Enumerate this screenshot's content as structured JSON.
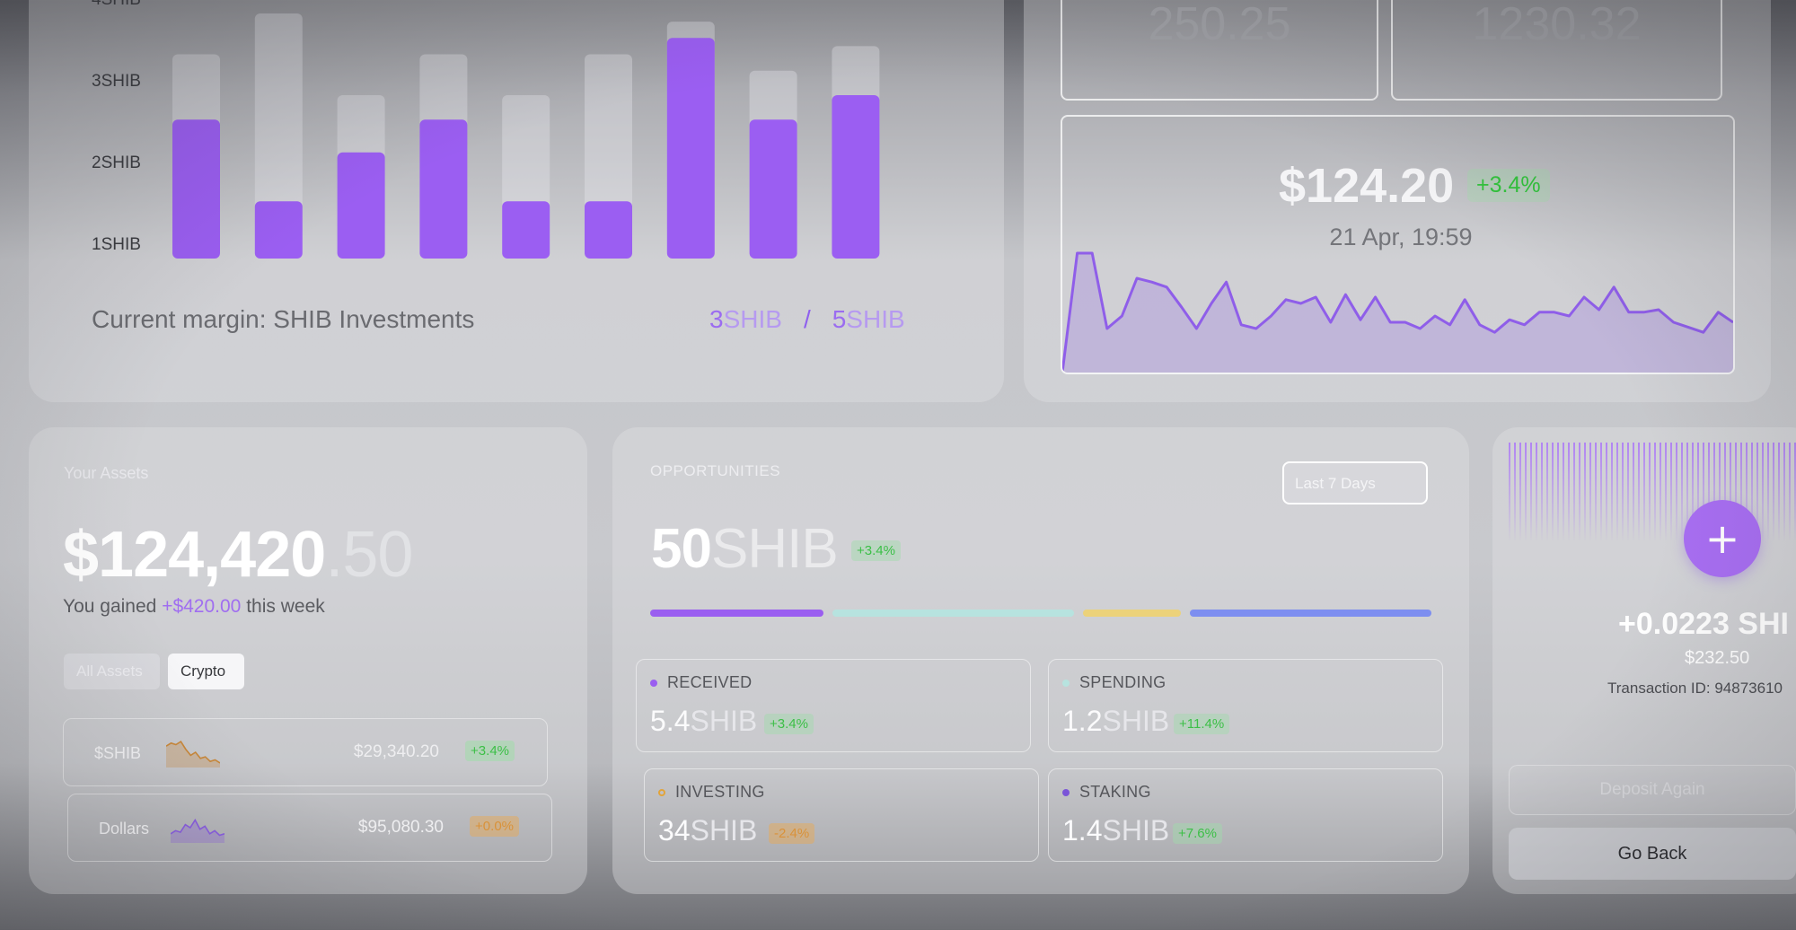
{
  "chart_data": {
    "type": "bar",
    "categories": [
      "",
      "",
      "",
      "",
      "",
      "",
      "",
      "",
      ""
    ],
    "values": [
      2.7,
      1.7,
      2.3,
      2.7,
      1.7,
      1.7,
      3.7,
      2.7,
      3.0
    ],
    "background_values": [
      3.5,
      4.0,
      3.0,
      3.5,
      3.0,
      3.5,
      3.9,
      3.3,
      3.6
    ],
    "yticks": [
      "1SHIB",
      "2SHIB",
      "3SHIB",
      "4SHIB"
    ],
    "ylim": [
      1,
      4
    ],
    "color": "#9b5ef2"
  },
  "margin": {
    "label": "Current margin: SHIB Investments",
    "current_num": "3",
    "current_unit": "SHIB",
    "separator": "/",
    "target_num": "5",
    "target_unit": "SHIB"
  },
  "stats": {
    "value_1": "250.25",
    "value_2": "1230.32"
  },
  "price": {
    "value": "$124.20",
    "change": "+3.4%",
    "date": "21 Apr, 19:59",
    "line": [
      0,
      0.95,
      0.95,
      0.35,
      0.45,
      0.75,
      0.72,
      0.68,
      0.52,
      0.35,
      0.55,
      0.72,
      0.38,
      0.35,
      0.45,
      0.58,
      0.55,
      0.6,
      0.4,
      0.62,
      0.42,
      0.6,
      0.4,
      0.4,
      0.35,
      0.45,
      0.38,
      0.58,
      0.38,
      0.32,
      0.42,
      0.38,
      0.48,
      0.48,
      0.45,
      0.6,
      0.5,
      0.68,
      0.48,
      0.48,
      0.5,
      0.4,
      0.36,
      0.32,
      0.48,
      0.4
    ]
  },
  "assets": {
    "title": "Your Assets",
    "total_main": "$124,420",
    "total_cents": ".50",
    "gained_prefix": "You gained",
    "gained_amount": "+$420.00",
    "gained_suffix": "this week",
    "tabs": [
      "All Assets",
      "Crypto"
    ],
    "rows": [
      {
        "name": "$SHIB",
        "value": "$29,340.20",
        "change": "+3.4%",
        "spark_color": "#c9883a",
        "spark": [
          0.7,
          0.8,
          0.75,
          0.85,
          0.6,
          0.4,
          0.5,
          0.3,
          0.35,
          0.2,
          0.25,
          0.15
        ]
      },
      {
        "name": "Dollars",
        "value": "$95,080.30",
        "change": "+0.0%",
        "spark_color": "#8a5ee0",
        "spark": [
          0.3,
          0.4,
          0.35,
          0.6,
          0.5,
          0.75,
          0.45,
          0.55,
          0.3,
          0.4,
          0.25,
          0.3
        ]
      }
    ]
  },
  "opportunities": {
    "title": "OPPORTUNITIES",
    "range_label": "Last 7 Days",
    "total_num": "50",
    "total_unit": "SHIB",
    "total_change": "+3.4%",
    "segments": [
      {
        "share": 0.23,
        "color": "#9a5ef0"
      },
      {
        "share": 0.32,
        "color": "#b7e3df"
      },
      {
        "share": 0.13,
        "color": "#ecd27a"
      },
      {
        "share": 0.32,
        "color": "#7d8ef0"
      }
    ],
    "metrics": [
      {
        "label": "RECEIVED",
        "num": "5.4",
        "unit": "SHIB",
        "change": "+3.4%",
        "dot_color": "#9a5ef0"
      },
      {
        "label": "SPENDING",
        "num": "1.2",
        "unit": "SHIB",
        "change": "+11.4%",
        "dot_color": "#b7e3df"
      },
      {
        "label": "INVESTING",
        "num": "34",
        "unit": "SHIB",
        "change": "-2.4%",
        "dot_color": "#e2a43a"
      },
      {
        "label": "STAKING",
        "num": "1.4",
        "unit": "SHIB",
        "change": "+7.6%",
        "dot_color": "#7a55d8"
      }
    ]
  },
  "deposit": {
    "plus_icon": "+",
    "amount": "+0.0223 SHI",
    "usd": "$232.50",
    "transaction": "Transaction ID: 94873610",
    "deposit_again": "Deposit Again",
    "go_back": "Go Back"
  }
}
